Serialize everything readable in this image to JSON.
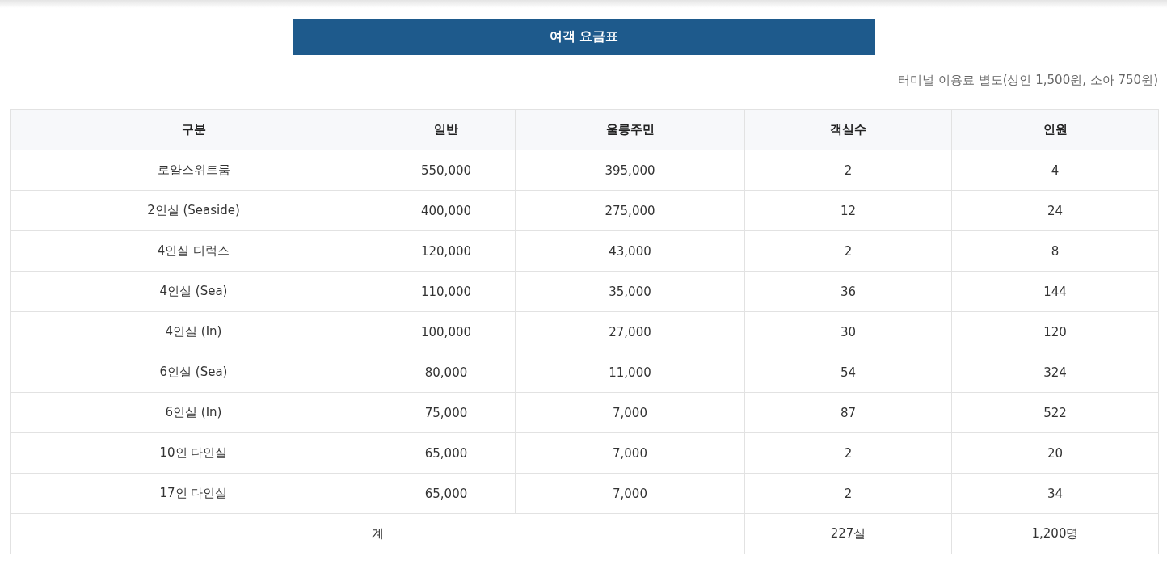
{
  "title": "여객 요금표",
  "note": "터미널 이용료 별도(성인 1,500원, 소아 750원)",
  "table": {
    "columns": [
      "구분",
      "일반",
      "울릉주민",
      "객실수",
      "인원"
    ],
    "rows": [
      [
        "로얄스위트룸",
        "550,000",
        "395,000",
        "2",
        "4"
      ],
      [
        "2인실 (Seaside)",
        "400,000",
        "275,000",
        "12",
        "24"
      ],
      [
        "4인실 디럭스",
        "120,000",
        "43,000",
        "2",
        "8"
      ],
      [
        "4인실 (Sea)",
        "110,000",
        "35,000",
        "36",
        "144"
      ],
      [
        "4인실 (In)",
        "100,000",
        "27,000",
        "30",
        "120"
      ],
      [
        "6인실 (Sea)",
        "80,000",
        "11,000",
        "54",
        "324"
      ],
      [
        "6인실 (In)",
        "75,000",
        "7,000",
        "87",
        "522"
      ],
      [
        "10인 다인실",
        "65,000",
        "7,000",
        "2",
        "20"
      ],
      [
        "17인 다인실",
        "65,000",
        "7,000",
        "2",
        "34"
      ]
    ],
    "total": {
      "label": "계",
      "rooms": "227실",
      "people": "1,200명"
    }
  }
}
